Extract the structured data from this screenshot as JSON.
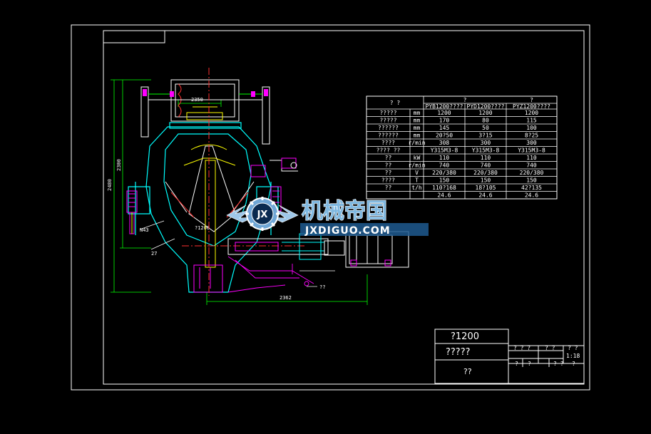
{
  "colors": {
    "background": "#000000",
    "frame": "#ffffff",
    "dimension": "#00ff00",
    "body": "#00ffff",
    "centerline": "#ff3030",
    "detail": "#ff00ff",
    "accent": "#ffff00",
    "watermark": "#7fb8e0"
  },
  "dimensions": {
    "d_350": "2350",
    "d_2300": "2300",
    "d_2480": "2480",
    "d_1200": "?1200",
    "d_2362": "2362",
    "d_n43": "N43",
    "d_27": "27",
    "d_77": "??"
  },
  "spec_table": {
    "header": [
      "?  ?",
      "",
      "?",
      "?"
    ],
    "subheader": [
      "",
      "",
      "PYB1200????",
      "PYD1200????",
      "PYZ1200????"
    ],
    "rows": [
      [
        "?????",
        "mm",
        "1200",
        "1200",
        "1200"
      ],
      [
        "?????",
        "mm",
        "170",
        "80",
        "115"
      ],
      [
        "??????",
        "mm",
        "145",
        "50",
        "100"
      ],
      [
        "??????",
        "mm",
        "20?50",
        "3?15",
        "8?25"
      ],
      [
        "????",
        "r/min",
        "308",
        "300",
        "300"
      ],
      [
        "????  ??",
        "",
        "Y315M3-8",
        "Y315M3-8",
        "Y315M3-8"
      ],
      [
        "??",
        "kW",
        "110",
        "110",
        "110"
      ],
      [
        "??",
        "r/min",
        "740",
        "740",
        "740"
      ],
      [
        "??",
        "V",
        "220/380",
        "220/380",
        "220/380"
      ],
      [
        "????",
        "T",
        "150",
        "150",
        "150"
      ],
      [
        "??",
        "t/h",
        "110?168",
        "18?105",
        "42?135"
      ],
      [
        "",
        "",
        "24.6",
        "24.6",
        "24.6"
      ]
    ]
  },
  "title_block": {
    "model": "?1200",
    "name": "?????",
    "bottom": "??",
    "row1": [
      "? ? ?",
      "? ?",
      "? ?"
    ],
    "scale": "1:18",
    "row2": [
      "?",
      "?",
      "? ?",
      "?"
    ]
  },
  "watermark": {
    "logo_letters": "JX",
    "chinese": "机械帝国",
    "english": "JXDIGUO.COM"
  }
}
